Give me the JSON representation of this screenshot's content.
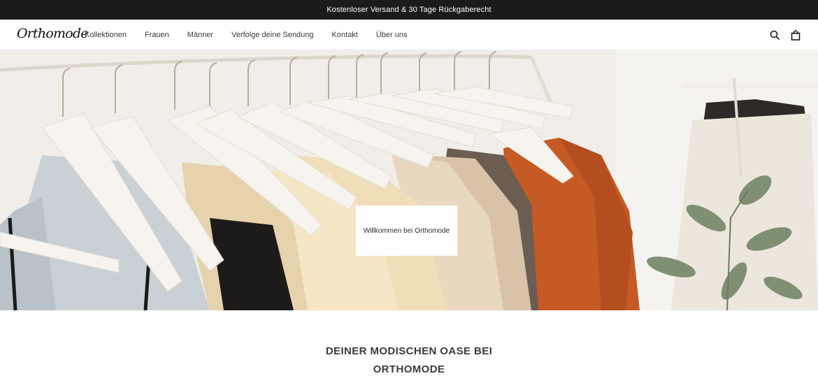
{
  "announcement": {
    "text": "Kostenloser Versand & 30 Tage Rückgaberecht"
  },
  "header": {
    "logo": "Orthomode",
    "nav": [
      {
        "label": "Kollektionen"
      },
      {
        "label": "Frauen"
      },
      {
        "label": "Männer"
      },
      {
        "label": "Verfolge deine Sendung"
      },
      {
        "label": "Kontakt"
      },
      {
        "label": "Über uns"
      }
    ],
    "icons": [
      "search-icon",
      "shopping-bag-icon"
    ]
  },
  "hero": {
    "button_label": "Willkommen bei Orthomode"
  },
  "welcome": {
    "title_line1": "DEINER MODISCHEN OASE BEI",
    "title_line2": "ORTHOMODE"
  },
  "colors": {
    "topbar": "#1c1b1b",
    "background": "#ffffff",
    "text": "#3b3b3b"
  }
}
